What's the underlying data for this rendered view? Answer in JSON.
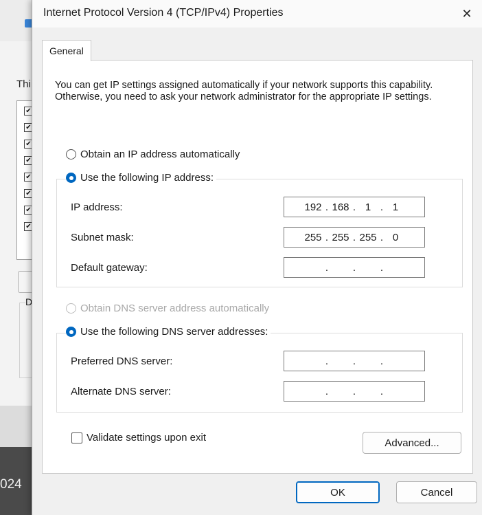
{
  "background": {
    "fragment_this": "Thi",
    "fragment_d": "D",
    "fragment_024": "024",
    "list_checks": [
      "✔",
      "✔",
      "✔",
      "✔",
      "✔",
      "✔",
      "✔",
      "✔"
    ]
  },
  "dialog": {
    "title": "Internet Protocol Version 4 (TCP/IPv4) Properties",
    "close_glyph": "✕",
    "tab_general": "General",
    "description": "You can get IP settings assigned automatically if your network supports this capability. Otherwise, you need to ask your network administrator for the appropriate IP settings.",
    "ip_section": {
      "auto_label": "Obtain an IP address automatically",
      "auto_selected": false,
      "manual_label": "Use the following IP address:",
      "manual_selected": true,
      "fields": {
        "ip_address": {
          "label": "IP address:",
          "octets": [
            "192",
            "168",
            "1",
            "1"
          ]
        },
        "subnet_mask": {
          "label": "Subnet mask:",
          "octets": [
            "255",
            "255",
            "255",
            "0"
          ]
        },
        "default_gateway": {
          "label": "Default gateway:",
          "octets": [
            "",
            "",
            "",
            ""
          ]
        }
      }
    },
    "dns_section": {
      "auto_label": "Obtain DNS server address automatically",
      "auto_enabled": false,
      "manual_label": "Use the following DNS server addresses:",
      "manual_selected": true,
      "fields": {
        "preferred": {
          "label": "Preferred DNS server:",
          "octets": [
            "",
            "",
            "",
            ""
          ]
        },
        "alternate": {
          "label": "Alternate DNS server:",
          "octets": [
            "",
            "",
            "",
            ""
          ]
        }
      }
    },
    "validate_label": "Validate settings upon exit",
    "validate_checked": false,
    "advanced_button": "Advanced...",
    "ok_button": "OK",
    "cancel_button": "Cancel"
  },
  "colors": {
    "accent": "#0067c0",
    "disabled_text": "#a8a8a8"
  }
}
